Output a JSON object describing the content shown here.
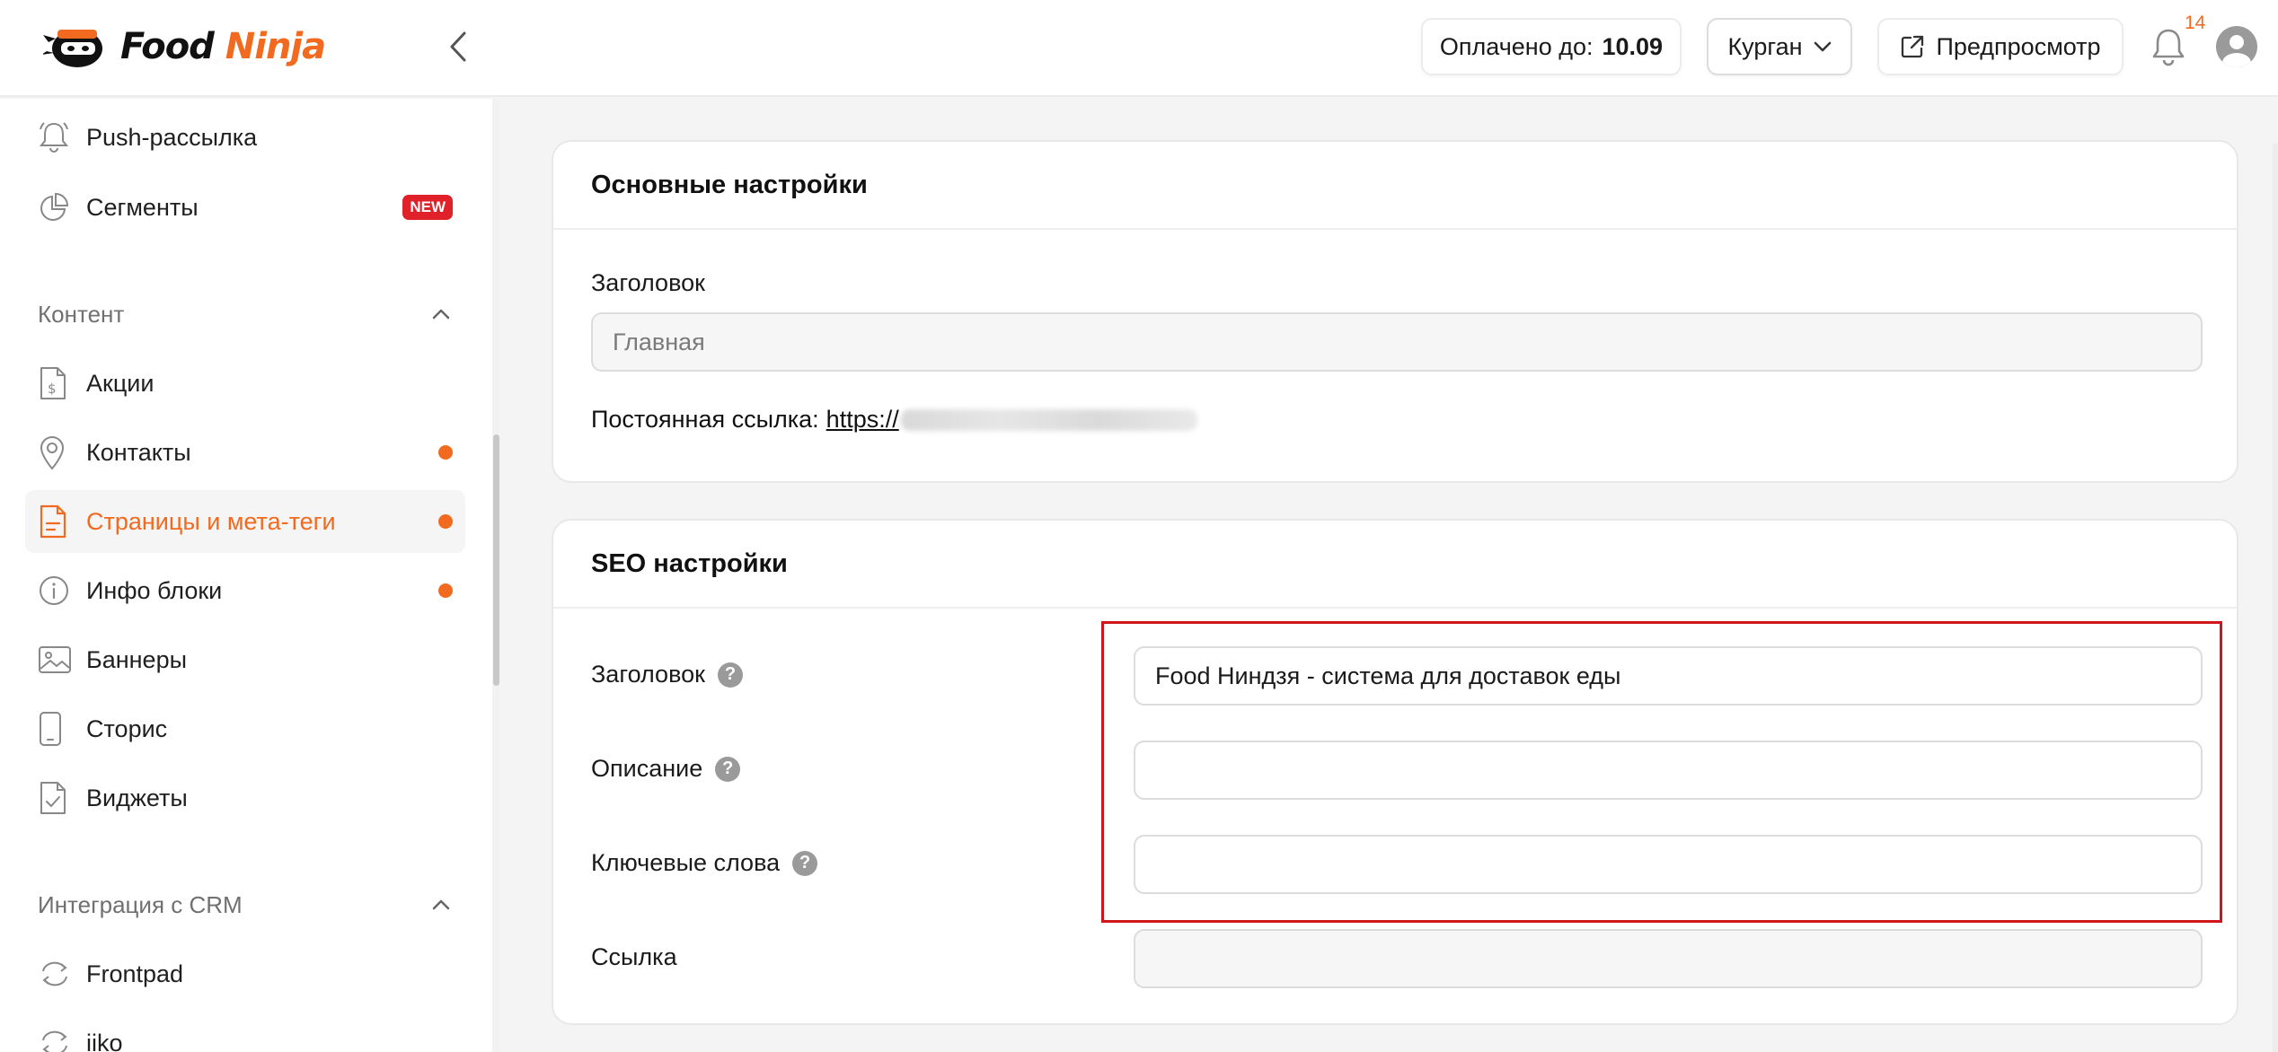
{
  "header": {
    "logo": {
      "word1": "Food",
      "word2": "Ninja"
    },
    "paid_label": "Оплачено до:",
    "paid_value": "10.09",
    "city": "Курган",
    "preview_label": "Предпросмотр",
    "notification_count": "14"
  },
  "sidebar": {
    "top_items": [
      {
        "label": "Push-рассылка"
      },
      {
        "label": "Сегменты",
        "badge": "NEW"
      }
    ],
    "content_section": "Контент",
    "content_items": [
      {
        "label": "Акции"
      },
      {
        "label": "Контакты"
      },
      {
        "label": "Страницы и мета-теги"
      },
      {
        "label": "Инфо блоки"
      },
      {
        "label": "Баннеры"
      },
      {
        "label": "Сторис"
      },
      {
        "label": "Виджеты"
      }
    ],
    "crm_section": "Интеграция с CRM",
    "crm_items": [
      {
        "label": "Frontpad"
      },
      {
        "label": "iiko"
      }
    ]
  },
  "main_settings": {
    "title": "Основные настройки",
    "heading_label": "Заголовок",
    "heading_value": "Главная",
    "permalink_label": "Постоянная ссылка:",
    "permalink_prefix": "https://"
  },
  "seo_settings": {
    "title": "SEO настройки",
    "help_glyph": "?",
    "fields": [
      {
        "label": "Заголовок",
        "value": "Food Ниндзя - система для доставок еды"
      },
      {
        "label": "Описание",
        "value": ""
      },
      {
        "label": "Ключевые слова",
        "value": ""
      },
      {
        "label": "Ссылка",
        "value": ""
      }
    ]
  },
  "colors": {
    "accent": "#f26a1f",
    "badge": "#e0212a",
    "highlight": "#d0161b"
  }
}
